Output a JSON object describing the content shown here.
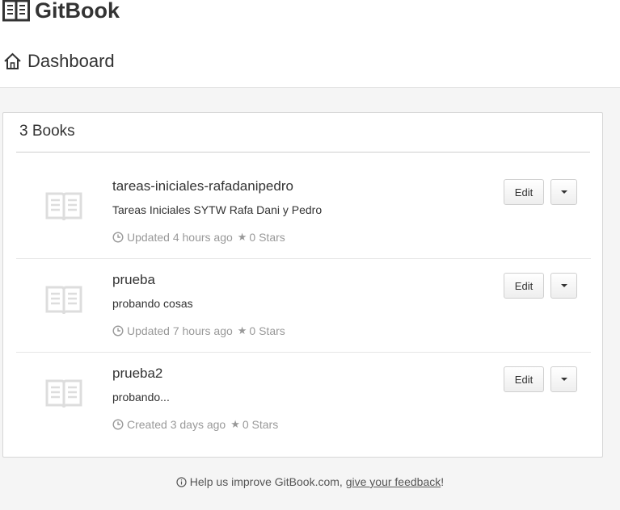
{
  "header": {
    "brand": "GitBook",
    "brand_icon": "book-logo-icon",
    "page_title": "Dashboard",
    "page_icon": "home-icon"
  },
  "books_panel": {
    "title": "3 Books",
    "books": [
      {
        "title": "tareas-iniciales-rafadanipedro",
        "description": "Tareas Iniciales SYTW Rafa Dani y Pedro",
        "time_status": "Updated 4 hours ago",
        "stars": "0 Stars",
        "edit_label": "Edit"
      },
      {
        "title": "prueba",
        "description": "probando cosas",
        "time_status": "Updated 7 hours ago",
        "stars": "0 Stars",
        "edit_label": "Edit"
      },
      {
        "title": "prueba2",
        "description": "probando...",
        "time_status": "Created 3 days ago",
        "stars": "0 Stars",
        "edit_label": "Edit"
      }
    ]
  },
  "footer": {
    "text": "Help us improve GitBook.com,",
    "link": "give your feedback",
    "suffix": "!"
  },
  "colors": {
    "background": "#f5f5f5",
    "text": "#333333",
    "muted": "#999999",
    "border": "#d6d6d6"
  }
}
